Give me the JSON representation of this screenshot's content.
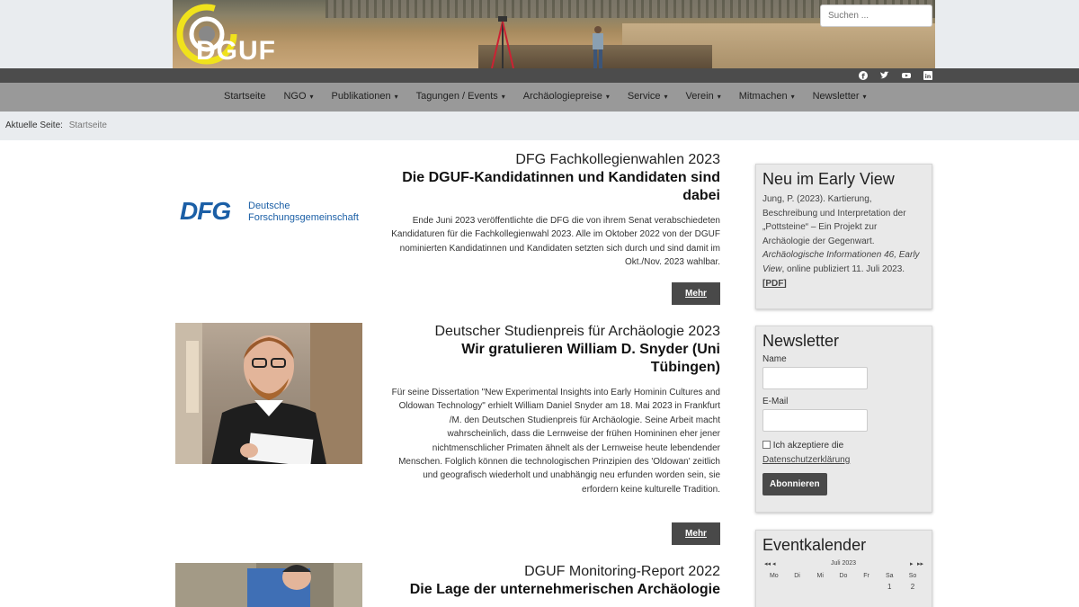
{
  "header": {
    "logo_text": "DGUF",
    "search_placeholder": "Suchen ..."
  },
  "social": [
    "facebook-icon",
    "twitter-icon",
    "youtube-icon",
    "linkedin-icon"
  ],
  "nav": [
    {
      "label": "Startseite",
      "dropdown": false
    },
    {
      "label": "NGO",
      "dropdown": true
    },
    {
      "label": "Publikationen",
      "dropdown": true
    },
    {
      "label": "Tagungen / Events",
      "dropdown": true
    },
    {
      "label": "Archäologiepreise",
      "dropdown": true
    },
    {
      "label": "Service",
      "dropdown": true
    },
    {
      "label": "Verein",
      "dropdown": true
    },
    {
      "label": "Mitmachen",
      "dropdown": true
    },
    {
      "label": "Newsletter",
      "dropdown": true
    }
  ],
  "breadcrumb": {
    "prefix": "Aktuelle Seite:",
    "current": "Startseite"
  },
  "articles": [
    {
      "kicker": "DFG Fachkollegienwahlen 2023",
      "title": "Die DGUF-Kandidatinnen und Kandidaten sind dabei",
      "text": "Ende Juni 2023 veröffentlichte die DFG die von ihrem Senat verabschiedeten Kandidaturen für die Fachkollegienwahl 2023. Alle im Oktober 2022 von der DGUF nominierten Kandidatinnen und Kandidaten setzten sich durch und sind damit im Okt./Nov. 2023 wahlbar.",
      "more": "Mehr",
      "image_logo": {
        "abbr": "DFG",
        "line1": "Deutsche",
        "line2": "Forschungsgemeinschaft"
      }
    },
    {
      "kicker": "Deutscher Studienpreis für Archäologie 2023",
      "title": "Wir gratulieren William D. Snyder (Uni Tübingen)",
      "text": "Für seine Dissertation \"New Experimental Insights into Early Hominin Cultures and Oldowan Technology\" erhielt William Daniel Snyder am 18. Mai 2023 in Frankfurt /M. den Deutschen Studienpreis für Archäologie. Seine Arbeit macht wahrscheinlich, dass die Lernweise der frühen Homininen eher jener nichtmenschlicher Primaten ähnelt als der Lernweise heute lebendender Menschen. Folglich können die technologischen Prinzipien des 'Oldowan' zeitlich und geografisch wiederholt und unabhängig neu erfunden worden sein, sie erfordern keine kulturelle Tradition.",
      "more": "Mehr"
    },
    {
      "kicker": "DGUF Monitoring-Report 2022",
      "title": "Die Lage der unternehmerischen Archäologie"
    }
  ],
  "sidebar": {
    "early_view": {
      "title": "Neu im Early View",
      "text_plain": "Jung, P. (2023). Kartierung, Beschreibung und Interpretation der „Pottsteine“ – Ein Projekt zur Archäologie der Gegenwart.",
      "journal": "Archäologische Informationen 46, Early View",
      "published": ", online publiziert 11. Juli 2023.",
      "pdf": "[PDF]"
    },
    "newsletter": {
      "title": "Newsletter",
      "name_label": "Name",
      "email_label": "E-Mail",
      "consent_text": "Ich akzeptiere die",
      "privacy_link": "Datenschutzerklärung",
      "submit": "Abonnieren"
    },
    "calendar": {
      "title": "Eventkalender",
      "prev_year": "◂◂",
      "prev": "◂",
      "month": "Juli 2023",
      "next": "▸",
      "next_year": "▸▸",
      "weekdays": [
        "Mo",
        "Di",
        "Mi",
        "Do",
        "Fr",
        "Sa",
        "So"
      ],
      "first_row": [
        "",
        "",
        "",
        "",
        "",
        "1",
        "2"
      ]
    }
  }
}
